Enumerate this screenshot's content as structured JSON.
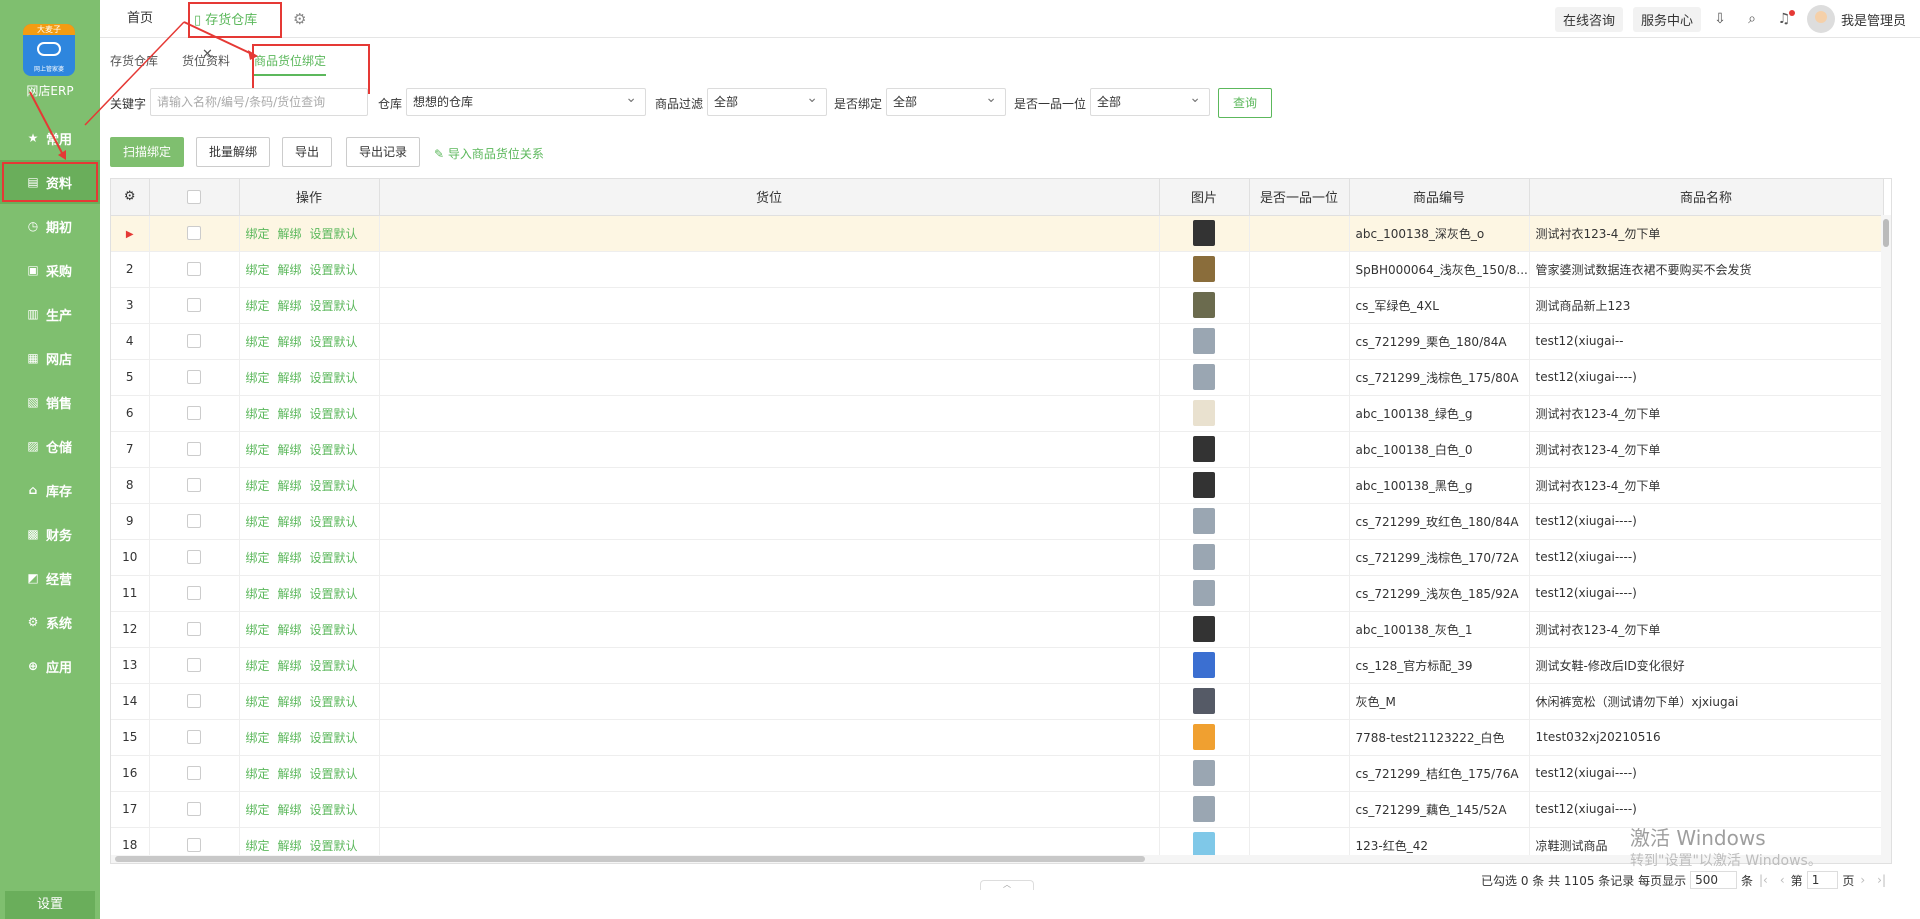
{
  "sidebar": {
    "logo_badge": "大麦子",
    "logo_sub": "网上管家婆",
    "brand": "网店ERP",
    "items": [
      {
        "label": "常用",
        "icon": "star-icon"
      },
      {
        "label": "资料",
        "icon": "document-icon"
      },
      {
        "label": "期初",
        "icon": "clock-icon"
      },
      {
        "label": "采购",
        "icon": "cart-icon"
      },
      {
        "label": "生产",
        "icon": "factory-icon"
      },
      {
        "label": "网店",
        "icon": "shop-icon"
      },
      {
        "label": "销售",
        "icon": "chart-icon"
      },
      {
        "label": "仓储",
        "icon": "warehouse-icon"
      },
      {
        "label": "库存",
        "icon": "home-icon"
      },
      {
        "label": "财务",
        "icon": "wallet-icon"
      },
      {
        "label": "经营",
        "icon": "trend-icon"
      },
      {
        "label": "系统",
        "icon": "gear-icon"
      },
      {
        "label": "应用",
        "icon": "plus-icon"
      }
    ],
    "settings_label": "设置"
  },
  "topbar": {
    "home_tab": "首页",
    "active_tab": "存货仓库",
    "close_glyph": "✕",
    "online_consult": "在线咨询",
    "service_center": "服务中心",
    "user_name": "我是管理员"
  },
  "subtabs": [
    "存货仓库",
    "货位资料",
    "商品货位绑定"
  ],
  "filters": {
    "keyword_label": "关键字",
    "keyword_placeholder": "请输入名称/编号/条码/货位查询",
    "warehouse_label": "仓库",
    "warehouse_value": "想想的仓库",
    "product_filter_label": "商品过滤",
    "product_filter_value": "全部",
    "bound_label": "是否绑定",
    "bound_value": "全部",
    "one_item_label": "是否一品一位",
    "one_item_value": "全部",
    "query_button": "查询"
  },
  "actions": {
    "scan_bind": "扫描绑定",
    "batch_unbind": "批量解绑",
    "export": "导出",
    "export_records": "导出记录",
    "import_link": "导入商品货位关系"
  },
  "table": {
    "headers": [
      "",
      "",
      "操作",
      "货位",
      "图片",
      "是否一品一位",
      "商品编号",
      "商品名称"
    ],
    "op_bind": "绑定",
    "op_unbind": "解绑",
    "op_default": "设置默认",
    "rows": [
      {
        "no": "",
        "code": "abc_100138_深灰色_o",
        "name": "测试衬衣123-4_勿下单",
        "thumb": "#333333"
      },
      {
        "no": "2",
        "code": "SpBH000064_浅灰色_150/8...",
        "name": "管家婆测试数据连衣裙不要购买不会发货",
        "thumb": "#8a6d3b"
      },
      {
        "no": "3",
        "code": "cs_军绿色_4XL",
        "name": "测试商品新上123",
        "thumb": "#6b6b4e"
      },
      {
        "no": "4",
        "code": "cs_721299_栗色_180/84A",
        "name": "test12(xiugai--",
        "thumb": "#9aa6b2"
      },
      {
        "no": "5",
        "code": "cs_721299_浅棕色_175/80A",
        "name": "test12(xiugai----)",
        "thumb": "#9aa6b2"
      },
      {
        "no": "6",
        "code": "abc_100138_绿色_g",
        "name": "测试衬衣123-4_勿下单",
        "thumb": "#e9e1cf"
      },
      {
        "no": "7",
        "code": "abc_100138_白色_0",
        "name": "测试衬衣123-4_勿下单",
        "thumb": "#333333"
      },
      {
        "no": "8",
        "code": "abc_100138_黑色_g",
        "name": "测试衬衣123-4_勿下单",
        "thumb": "#333333"
      },
      {
        "no": "9",
        "code": "cs_721299_玫红色_180/84A",
        "name": "test12(xiugai----)",
        "thumb": "#9aa6b2"
      },
      {
        "no": "10",
        "code": "cs_721299_浅棕色_170/72A",
        "name": "test12(xiugai----)",
        "thumb": "#9aa6b2"
      },
      {
        "no": "11",
        "code": "cs_721299_浅灰色_185/92A",
        "name": "test12(xiugai----)",
        "thumb": "#9aa6b2"
      },
      {
        "no": "12",
        "code": "abc_100138_灰色_1",
        "name": "测试衬衣123-4_勿下单",
        "thumb": "#333333"
      },
      {
        "no": "13",
        "code": "cs_128_官方标配_39",
        "name": "测试女鞋-修改后ID变化很好",
        "thumb": "#3b6fd1"
      },
      {
        "no": "14",
        "code": "灰色_M",
        "name": "休闲裤宽松（测试请勿下单）xjxiugai",
        "thumb": "#555a66"
      },
      {
        "no": "15",
        "code": "7788-test21123222_白色",
        "name": "1test032xj20210516",
        "thumb": "#f0a030"
      },
      {
        "no": "16",
        "code": "cs_721299_桔红色_175/76A",
        "name": "test12(xiugai----)",
        "thumb": "#9aa6b2"
      },
      {
        "no": "17",
        "code": "cs_721299_藕色_145/52A",
        "name": "test12(xiugai----)",
        "thumb": "#9aa6b2"
      },
      {
        "no": "18",
        "code": "123-红色_42",
        "name": "凉鞋测试商品",
        "thumb": "#7fc8e8"
      }
    ]
  },
  "footer": {
    "summary": "已勾选 0 条 共 1105 条记录 每页显示",
    "page_size": "500",
    "unit": "条",
    "page_prefix": "第",
    "page_value": "1",
    "page_suffix": "页"
  },
  "watermark": {
    "title": "激活 Windows",
    "subtitle": "转到\"设置\"以激活 Windows。"
  },
  "colors": {
    "sidebar": "#7fbf6f",
    "accent": "#5cb85c",
    "annotation": "#e53935"
  }
}
